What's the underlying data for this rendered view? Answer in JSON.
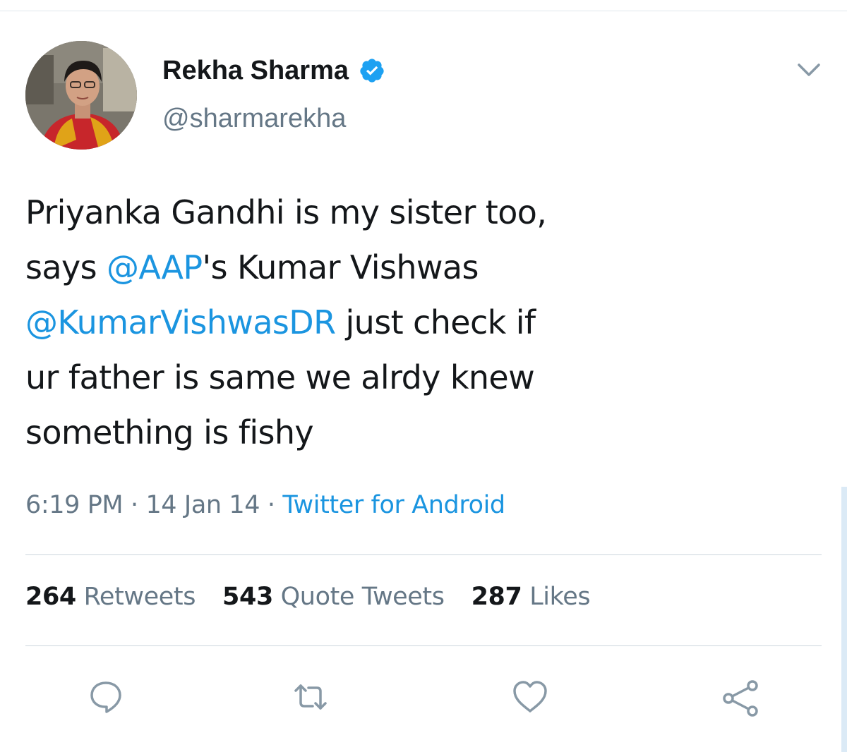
{
  "tweet": {
    "author": {
      "display_name": "Rekha Sharma",
      "handle": "@sharmarekha",
      "verified": true,
      "verified_icon": "verified-badge-icon",
      "accent_color": "#1da1f2"
    },
    "text_lines": [
      [
        {
          "text": "Priyanka Gandhi is my sister too,",
          "link": false
        }
      ],
      [
        {
          "text": "says ",
          "link": false
        },
        {
          "text": "@AAP",
          "link": true
        },
        {
          "text": "'s Kumar Vishwas",
          "link": false
        }
      ],
      [
        {
          "text": "@KumarVishwasDR",
          "link": true
        },
        {
          "text": " just check if",
          "link": false
        }
      ],
      [
        {
          "text": "ur father is same we alrdy knew",
          "link": false
        }
      ],
      [
        {
          "text": "something is fishy",
          "link": false
        }
      ]
    ],
    "meta": {
      "time": "6:19 PM",
      "separator": "·",
      "date": "14 Jan 14",
      "source": "Twitter for Android"
    },
    "stats": [
      {
        "count": "264",
        "label": "Retweets"
      },
      {
        "count": "543",
        "label": "Quote Tweets"
      },
      {
        "count": "287",
        "label": "Likes"
      }
    ],
    "actions": [
      {
        "name": "reply-icon"
      },
      {
        "name": "retweet-icon"
      },
      {
        "name": "like-icon"
      },
      {
        "name": "share-icon"
      }
    ],
    "menu_icon": "chevron-down-icon"
  },
  "colors": {
    "text": "#14171a",
    "secondary": "#657786",
    "link": "#1b95e0",
    "divider": "#ccd6dd"
  }
}
